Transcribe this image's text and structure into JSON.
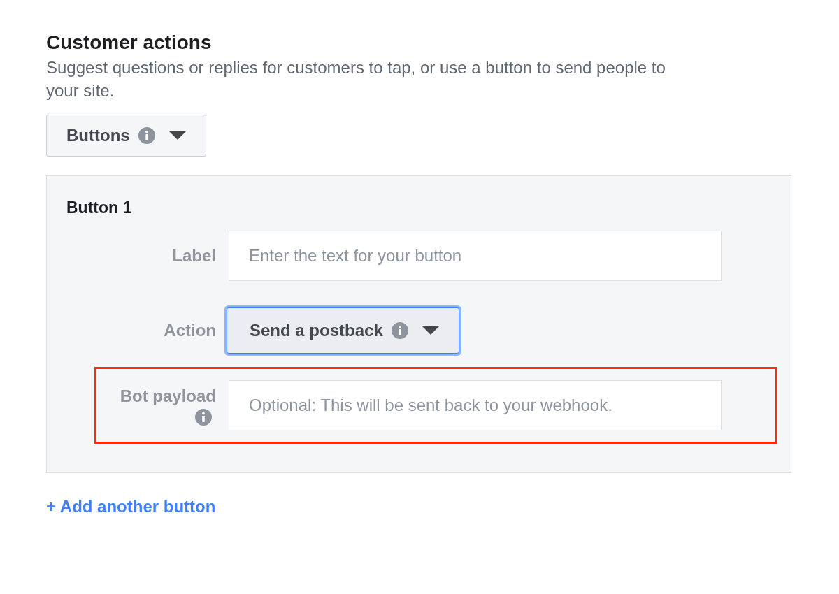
{
  "section": {
    "title": "Customer actions",
    "description": "Suggest questions or replies for customers to tap, or use a button to send people to your site."
  },
  "type_select": {
    "value": "Buttons",
    "info": true
  },
  "buttons": [
    {
      "heading": "Button 1",
      "fields": [
        {
          "kind": "text",
          "label": "Label",
          "info": false,
          "placeholder": "Enter the text for your button",
          "highlighted": false
        },
        {
          "kind": "select",
          "label": "Action",
          "info": false,
          "value": "Send a postback",
          "value_info": true,
          "focused": true,
          "highlighted": false
        },
        {
          "kind": "text",
          "label": "Bot payload",
          "info": true,
          "placeholder": "Optional: This will be sent back to your webhook.",
          "highlighted": true
        }
      ]
    }
  ],
  "add_link": "+ Add another button"
}
